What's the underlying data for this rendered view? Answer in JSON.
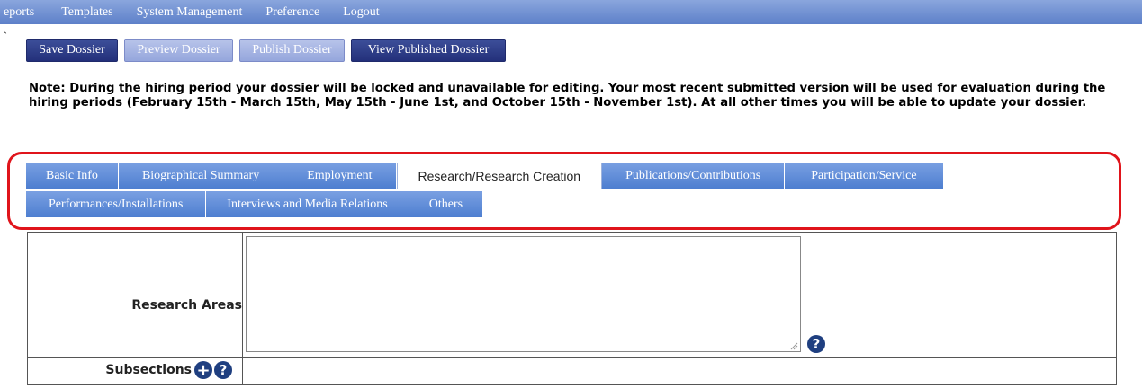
{
  "top_menu": {
    "items": [
      "eports",
      "Templates",
      "System Management",
      "Preference",
      "Logout"
    ]
  },
  "stray_mark": "`",
  "actions": {
    "save": "Save Dossier",
    "preview": "Preview Dossier",
    "publish": "Publish Dossier",
    "view_published": "View Published Dossier"
  },
  "note": "Note: During the hiring period your dossier will be locked and unavailable for editing. Your most recent submitted version will be used for evaluation during the hiring periods (February 15th - March 15th, May 15th - June 1st, and October 15th - November 1st). At all other times you will be able to update your dossier.",
  "tabs": {
    "row1": [
      "Basic Info",
      "Biographical Summary",
      "Employment",
      "Research/Research Creation",
      "Publications/Contributions",
      "Participation/Service"
    ],
    "row2": [
      "Performances/Installations",
      "Interviews and Media Relations",
      "Others"
    ],
    "active": "Research/Research Creation"
  },
  "form": {
    "research_areas_label": "Research Areas",
    "research_areas_value": "",
    "subsections_label": "Subsections"
  },
  "icons": {
    "help": "?",
    "add": "+"
  },
  "colors": {
    "menu_blue": "#5d80c9",
    "tab_blue": "#4d7ed0",
    "button_dark": "#23307a",
    "highlight_red": "#e0141b",
    "icon_navy": "#1f3f80"
  }
}
